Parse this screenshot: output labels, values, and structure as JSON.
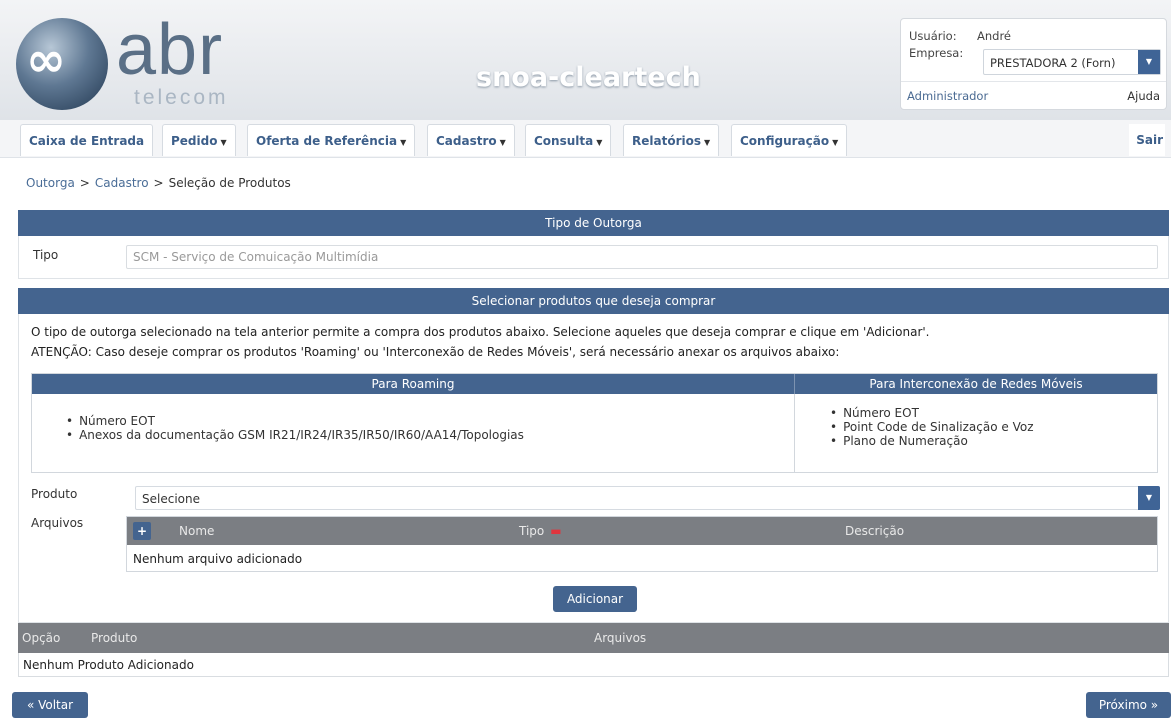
{
  "header": {
    "logo_mark": "∞",
    "logo_name": "abr",
    "logo_sub": "telecom",
    "app_title": "snoa-cleartech",
    "user_label": "Usuário:",
    "user_value": "André",
    "company_label": "Empresa:",
    "company_value": "PRESTADORA 2 (Forn)",
    "role": "Administrador",
    "help": "Ajuda"
  },
  "nav": {
    "items": [
      {
        "label": "Caixa de Entrada",
        "has_menu": false
      },
      {
        "label": "Pedido",
        "has_menu": true
      },
      {
        "label": "Oferta de Referência",
        "has_menu": true
      },
      {
        "label": "Cadastro",
        "has_menu": true
      },
      {
        "label": "Consulta",
        "has_menu": true
      },
      {
        "label": "Relatórios",
        "has_menu": true
      },
      {
        "label": "Configuração",
        "has_menu": true
      }
    ],
    "caret": "▼",
    "exit": "Sair"
  },
  "breadcrumb": {
    "items": [
      "Outorga",
      "Cadastro",
      "Seleção de Produtos"
    ],
    "separator": ">"
  },
  "tipo_section": {
    "title": "Tipo de Outorga",
    "label": "Tipo",
    "value": "SCM - Serviço de Comuicação Multimídia"
  },
  "produtos_section": {
    "title": "Selecionar produtos que deseja comprar",
    "instruction": "O tipo de outorga selecionado na tela anterior permite a compra dos produtos abaixo. Selecione aqueles que deseja comprar e clique em 'Adicionar'.",
    "warning": "ATENÇÃO: Caso deseje comprar os produtos 'Roaming' ou 'Interconexão de Redes Móveis', será necessário anexar os arquivos abaixo:",
    "roaming": {
      "title": "Para Roaming",
      "items": [
        "Número EOT",
        "Anexos da documentação GSM IR21/IR24/IR35/IR50/IR60/AA14/Topologias"
      ]
    },
    "interconexao": {
      "title": "Para Interconexão de Redes Móveis",
      "items": [
        "Número EOT",
        "Point Code de Sinalização e Voz",
        "Plano de Numeração"
      ]
    },
    "produto_label": "Produto",
    "produto_value": "Selecione",
    "arquivos_label": "Arquivos",
    "files_columns": {
      "nome": "Nome",
      "tipo": "Tipo",
      "descricao": "Descrição"
    },
    "required_mark": "▬",
    "add_symbol": "+",
    "files_empty": "Nenhum arquivo adicionado",
    "add_button": "Adicionar"
  },
  "produtos_table": {
    "columns": {
      "opcao": "Opção",
      "produto": "Produto",
      "arquivos": "Arquivos"
    },
    "empty": "Nenhum Produto Adicionado"
  },
  "footer": {
    "back": "« Voltar",
    "next": "Próximo »"
  },
  "colors": {
    "primary": "#44648f",
    "table_header_gray": "#7b7e83",
    "required": "#e0353e"
  }
}
